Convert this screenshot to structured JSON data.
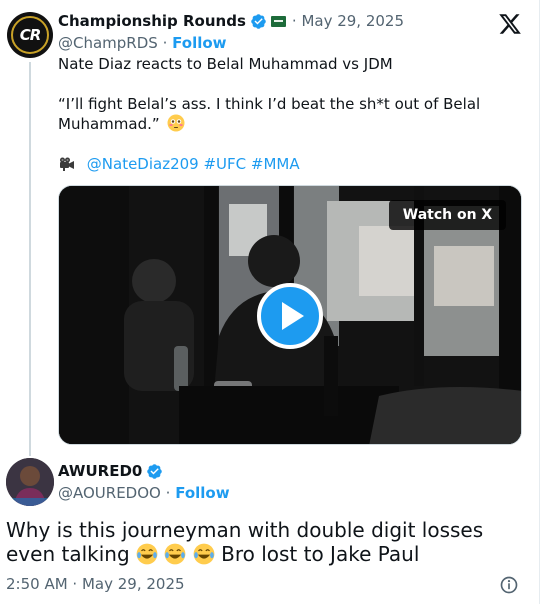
{
  "quoted_tweet": {
    "author_name": "Championship Rounds",
    "avatar_text": "CR",
    "handle": "@ChampRDS",
    "follow_label": "Follow",
    "date": "May 29, 2025",
    "text_line1": "Nate Diaz reacts to Belal Muhammad vs JDM",
    "text_line2": "“I’ll fight Belal’s ass. I think I’d beat the sh*t out of Belal",
    "text_line3": "Muhammad.”",
    "mentions": "@NateDiaz209 #UFC #MMA",
    "watch_label": "Watch on X"
  },
  "reply": {
    "author_name": "AWURED0",
    "handle": "@AOUREDOO",
    "follow_label": "Follow",
    "text_part1": "Why is this journeyman with double digit losses even talking",
    "text_part2": "Bro lost to Jake Paul",
    "timestamp": "2:50 AM · May 29, 2025"
  },
  "icons": {
    "verified": "verified-badge-icon",
    "flag": "flag-icon",
    "x_logo": "x-logo-icon",
    "play": "play-icon",
    "video_camera": "video-camera-icon",
    "flushed_face": "flushed-face-emoji",
    "laughing_face": "tears-of-joy-emoji",
    "info": "info-icon"
  },
  "colors": {
    "accent": "#1d9bf0",
    "text": "#0f1419",
    "muted": "#536471"
  }
}
